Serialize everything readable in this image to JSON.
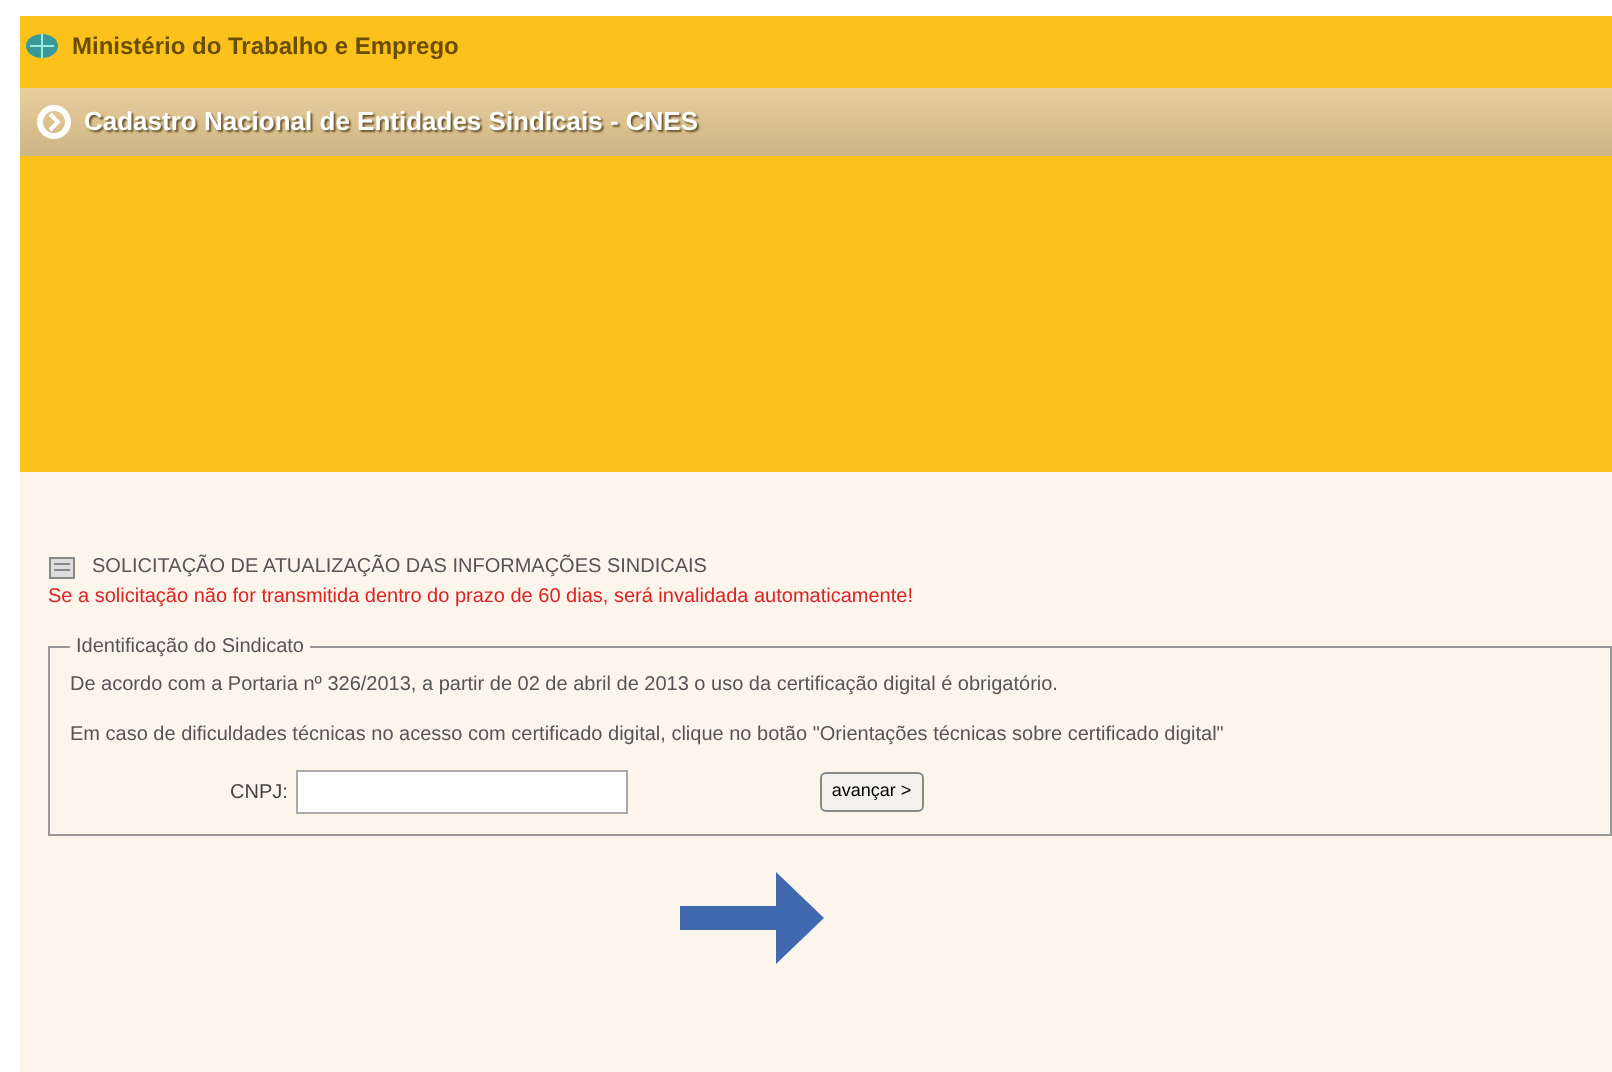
{
  "header": {
    "ministry": "Ministério do Trabalho e Emprego",
    "system_title": "Cadastro Nacional de Entidades Sindicais - CNES"
  },
  "form": {
    "title": "SOLICITAÇÃO DE ATUALIZAÇÃO DAS INFORMAÇÕES SINDICAIS",
    "warning": "Se a solicitação não for transmitida dentro do prazo de 60 dias, será invalidada automaticamente!",
    "fieldset": {
      "legend": "Identificação do Sindicato",
      "paragraphs": [
        "De acordo com a Portaria nº 326/2013, a partir de 02 de abril de 2013 o uso da certificação digital é obrigatório.",
        "Em caso de dificuldades técnicas no acesso com certificado digital, clique no botão \"Orientações técnicas sobre certificado digital\""
      ],
      "field_label": "CNPJ:",
      "button": "avançar >"
    }
  }
}
